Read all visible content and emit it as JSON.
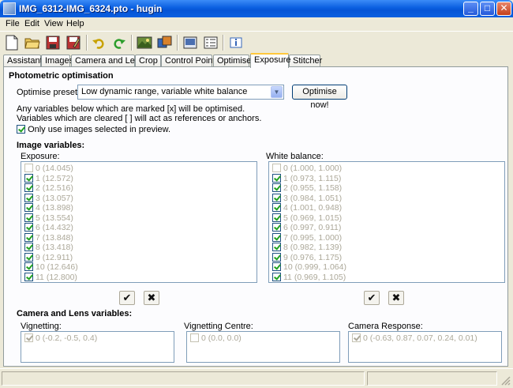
{
  "window": {
    "title": "IMG_6312-IMG_6324.pto - hugin"
  },
  "menu": {
    "file": "File",
    "edit": "Edit",
    "view": "View",
    "help": "Help"
  },
  "tabs": [
    "Assistant",
    "Images",
    "Camera and Lens",
    "Crop",
    "Control Points",
    "Optimiser",
    "Exposure",
    "Stitcher"
  ],
  "active_tab": "Exposure",
  "photometric": {
    "heading": "Photometric optimisation",
    "preset_label": "Optimise preset",
    "preset_value": "Low dynamic range, variable white balance",
    "optimise_button": "Optimise now!",
    "info_line1": "Any variables below which are marked [x] will be optimised.",
    "info_line2": "Variables which are cleared [ ] will act as references or anchors.",
    "only_selected_label": "Only use images selected in preview."
  },
  "image_vars": {
    "heading": "Image variables:",
    "exposure_label": "Exposure:",
    "exposure_items": [
      {
        "text": "0 (14.045)",
        "checked": false
      },
      {
        "text": "1 (12.572)",
        "checked": true
      },
      {
        "text": "2 (12.516)",
        "checked": true
      },
      {
        "text": "3 (13.057)",
        "checked": true
      },
      {
        "text": "4 (13.898)",
        "checked": true
      },
      {
        "text": "5 (13.554)",
        "checked": true
      },
      {
        "text": "6 (14.432)",
        "checked": true
      },
      {
        "text": "7 (13.848)",
        "checked": true
      },
      {
        "text": "8 (13.418)",
        "checked": true
      },
      {
        "text": "9 (12.911)",
        "checked": true
      },
      {
        "text": "10 (12.646)",
        "checked": true
      },
      {
        "text": "11 (12.800)",
        "checked": true
      }
    ],
    "wb_label": "White balance:",
    "wb_items": [
      {
        "text": "0 (1.000, 1.000)",
        "checked": false
      },
      {
        "text": "1 (0.973, 1.115)",
        "checked": true
      },
      {
        "text": "2 (0.955, 1.158)",
        "checked": true
      },
      {
        "text": "3 (0.984, 1.051)",
        "checked": true
      },
      {
        "text": "4 (1.001, 0.948)",
        "checked": true
      },
      {
        "text": "5 (0.969, 1.015)",
        "checked": true
      },
      {
        "text": "6 (0.997, 0.911)",
        "checked": true
      },
      {
        "text": "7 (0.995, 1.000)",
        "checked": true
      },
      {
        "text": "8 (0.982, 1.139)",
        "checked": true
      },
      {
        "text": "9 (0.976, 1.175)",
        "checked": true
      },
      {
        "text": "10 (0.999, 1.064)",
        "checked": true
      },
      {
        "text": "11 (0.969, 1.105)",
        "checked": true
      }
    ],
    "select_all_glyph": "✔",
    "clear_all_glyph": "✖"
  },
  "lens_vars": {
    "heading": "Camera and Lens variables:",
    "vignetting_label": "Vignetting:",
    "vignetting_item": "0 (-0.2, -0.5, 0.4)",
    "vig_centre_label": "Vignetting Centre:",
    "vig_centre_item": "0 (0.0, 0.0)",
    "response_label": "Camera Response:",
    "response_item": "0 (-0.63, 0.87, 0.07, 0.24, 0.01)"
  }
}
